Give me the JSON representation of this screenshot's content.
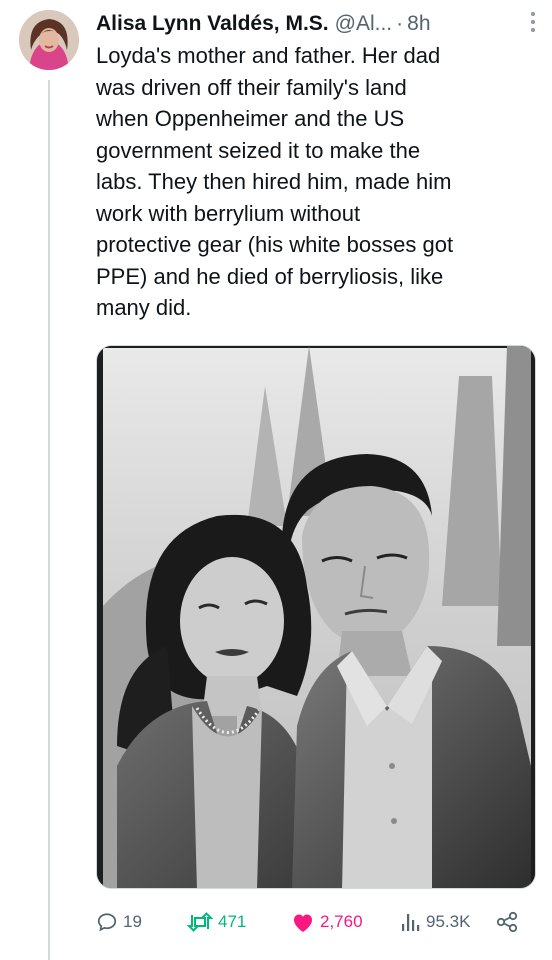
{
  "tweet": {
    "author_name": "Alisa Lynn Valdés, M.S.",
    "handle": "@Al...",
    "separator": "·",
    "time": "8h",
    "text": "Loyda's mother and father. Her dad\nwas driven off their family's land\nwhen Oppenheimer and the US\ngovernment seized it to make the\nlabs. They then hired him, made him\nwork with berrylium without\nprotective gear (his white bosses got\nPPE) and he died of berryliosis, like\nmany did."
  },
  "actions": {
    "replies": "19",
    "reposts": "471",
    "likes": "2,760",
    "views": "95.3K"
  },
  "icons": {
    "reply": "reply-icon",
    "repost": "repost-icon",
    "like": "heart-icon",
    "views": "views-icon",
    "share": "share-icon",
    "more": "more-icon"
  },
  "colors": {
    "text": "#0f1419",
    "secondary": "#536471",
    "repost_active": "#00ba7c",
    "like_active": "#f91880",
    "thread_line": "#cfd9de"
  }
}
